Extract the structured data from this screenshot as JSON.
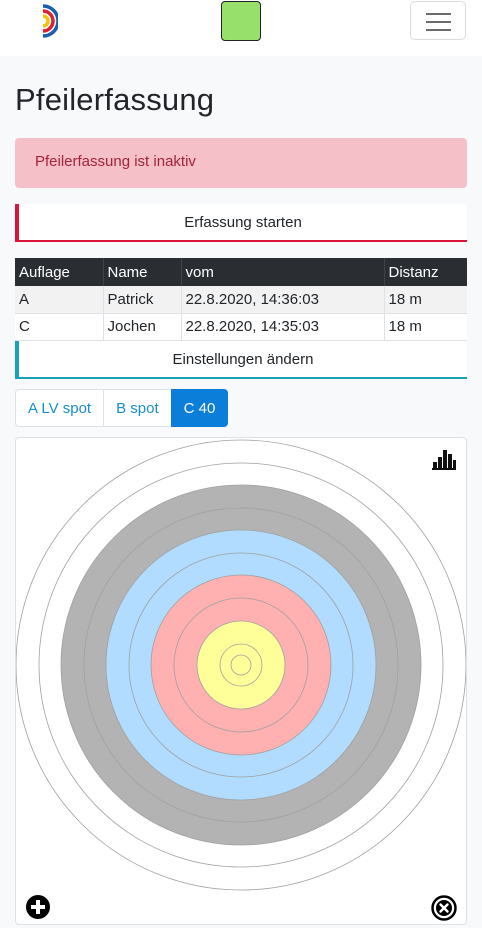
{
  "navbar": {
    "logo_icon": "target-logo-icon",
    "status_color": "#98e06c",
    "menu_icon": "hamburger-icon"
  },
  "page": {
    "title": "Pfeilerfassung"
  },
  "alert": {
    "text": "Pfeilerfassung ist inaktiv",
    "background": "#f5c0c8",
    "color": "#a3243b"
  },
  "actions": {
    "start_label": "Erfassung starten",
    "settings_label": "Einstellungen ändern"
  },
  "sessions_table": {
    "headers": [
      "Auflage",
      "Name",
      "vom",
      "Distanz"
    ],
    "rows": [
      [
        "A",
        "Patrick",
        "22.8.2020, 14:36:03",
        "18 m"
      ],
      [
        "C",
        "Jochen",
        "22.8.2020, 14:35:03",
        "18 m"
      ]
    ]
  },
  "target_tabs": [
    {
      "label": "A LV spot",
      "active": false
    },
    {
      "label": "B spot",
      "active": false
    },
    {
      "label": "C 40",
      "active": true
    }
  ],
  "target": {
    "face": "C 40",
    "ring_colors": [
      "#ffffff",
      "#ffffff",
      "#b3b3b3",
      "#b3b3b3",
      "#b1dcff",
      "#b1dcff",
      "#ffb0b0",
      "#ffb0b0",
      "#ffff99",
      "#ffff99",
      "#ffff99"
    ],
    "icons": {
      "stats": "bar-chart-icon",
      "add": "plus-circle-icon",
      "clear": "x-circle-icon"
    }
  }
}
